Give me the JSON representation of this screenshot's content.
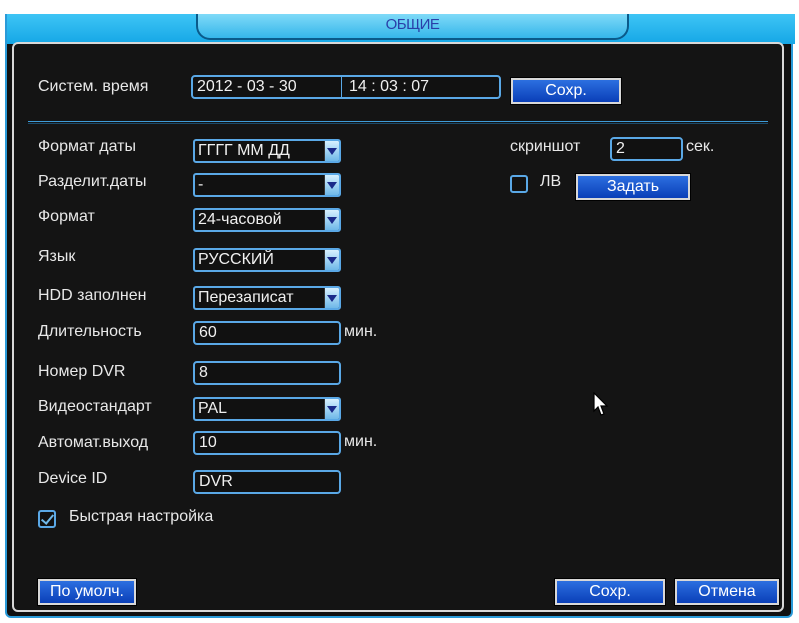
{
  "window": {
    "title": "ОБЩИЕ"
  },
  "system_time": {
    "label": "Систем. время",
    "date": "2012  -  03  -  30",
    "time": "14  :  03  :  07",
    "save_label": "Сохр."
  },
  "settings": {
    "date_format": {
      "label": "Формат даты",
      "value": "ГГГГ ММ ДД"
    },
    "date_separator": {
      "label": "Разделит.даты",
      "value": "-"
    },
    "time_format": {
      "label": "Формат",
      "value": "24-часовой"
    },
    "language": {
      "label": "Язык",
      "value": "РУССКИЙ"
    },
    "hdd_full": {
      "label": "HDD заполнен",
      "value": "Перезаписат"
    },
    "duration": {
      "label": "Длительность",
      "value": "60",
      "unit": "мин."
    },
    "dvr_number": {
      "label": "Номер DVR",
      "value": "8"
    },
    "video_standard": {
      "label": "Видеостандарт",
      "value": "PAL"
    },
    "auto_logout": {
      "label": "Автомат.выход",
      "value": "10",
      "unit": "мин."
    },
    "device_id": {
      "label": "Device ID",
      "value": "DVR"
    },
    "quick_setup": {
      "label": "Быстрая настройка",
      "checked": true
    }
  },
  "right": {
    "screenshot": {
      "label": "скриншот",
      "value": "2",
      "unit": "сек."
    },
    "dst": {
      "label": "ЛВ",
      "checked": false,
      "set_label": "Задать"
    }
  },
  "footer": {
    "default_label": "По умолч.",
    "save_label": "Сохр.",
    "cancel_label": "Отмена"
  },
  "colors": {
    "accent": "#2a9ad8",
    "button": "#0a3fb8",
    "background": "#101010"
  }
}
